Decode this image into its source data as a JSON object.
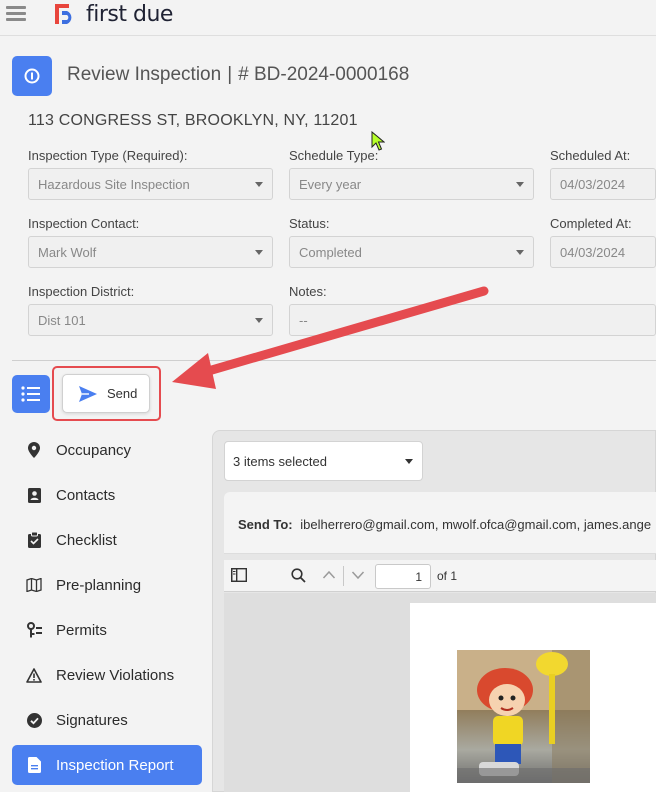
{
  "app": {
    "name": "first due"
  },
  "header": {
    "title": "Review Inspection",
    "separator": "|",
    "record_id": "# BD-2024-0000168",
    "address": "113 CONGRESS ST, BROOKLYN, NY, 11201"
  },
  "form": {
    "inspection_type": {
      "label": "Inspection Type (Required):",
      "value": "Hazardous Site Inspection"
    },
    "schedule_type": {
      "label": "Schedule Type:",
      "value": "Every year"
    },
    "scheduled_at": {
      "label": "Scheduled At:",
      "value": "04/03/2024"
    },
    "inspection_contact": {
      "label": "Inspection Contact:",
      "value": "Mark Wolf"
    },
    "status": {
      "label": "Status:",
      "value": "Completed"
    },
    "completed_at": {
      "label": "Completed At:",
      "value": "04/03/2024"
    },
    "inspection_district": {
      "label": "Inspection District:",
      "value": "Dist 101"
    },
    "notes": {
      "label": "Notes:",
      "value": "--"
    }
  },
  "toolbar": {
    "send_label": "Send"
  },
  "sidebar": {
    "items": [
      {
        "label": "Occupancy",
        "icon": "location-pin-icon"
      },
      {
        "label": "Contacts",
        "icon": "contact-card-icon"
      },
      {
        "label": "Checklist",
        "icon": "clipboard-check-icon"
      },
      {
        "label": "Pre-planning",
        "icon": "map-icon"
      },
      {
        "label": "Permits",
        "icon": "key-list-icon"
      },
      {
        "label": "Review Violations",
        "icon": "warning-icon"
      },
      {
        "label": "Signatures",
        "icon": "check-circle-icon"
      },
      {
        "label": "Inspection Report",
        "icon": "document-icon",
        "active": true
      }
    ]
  },
  "report": {
    "items_selected": "3 items selected",
    "send_to_label": "Send To:",
    "send_to_value": "ibelherrero@gmail.com, mwolf.ofca@gmail.com, james.ange",
    "page_number": "1",
    "page_total": "of 1"
  },
  "colors": {
    "primary": "#4a7ff0",
    "highlight": "#e54b4f",
    "logo_red": "#e8453c",
    "logo_blue": "#3d6fe0"
  }
}
